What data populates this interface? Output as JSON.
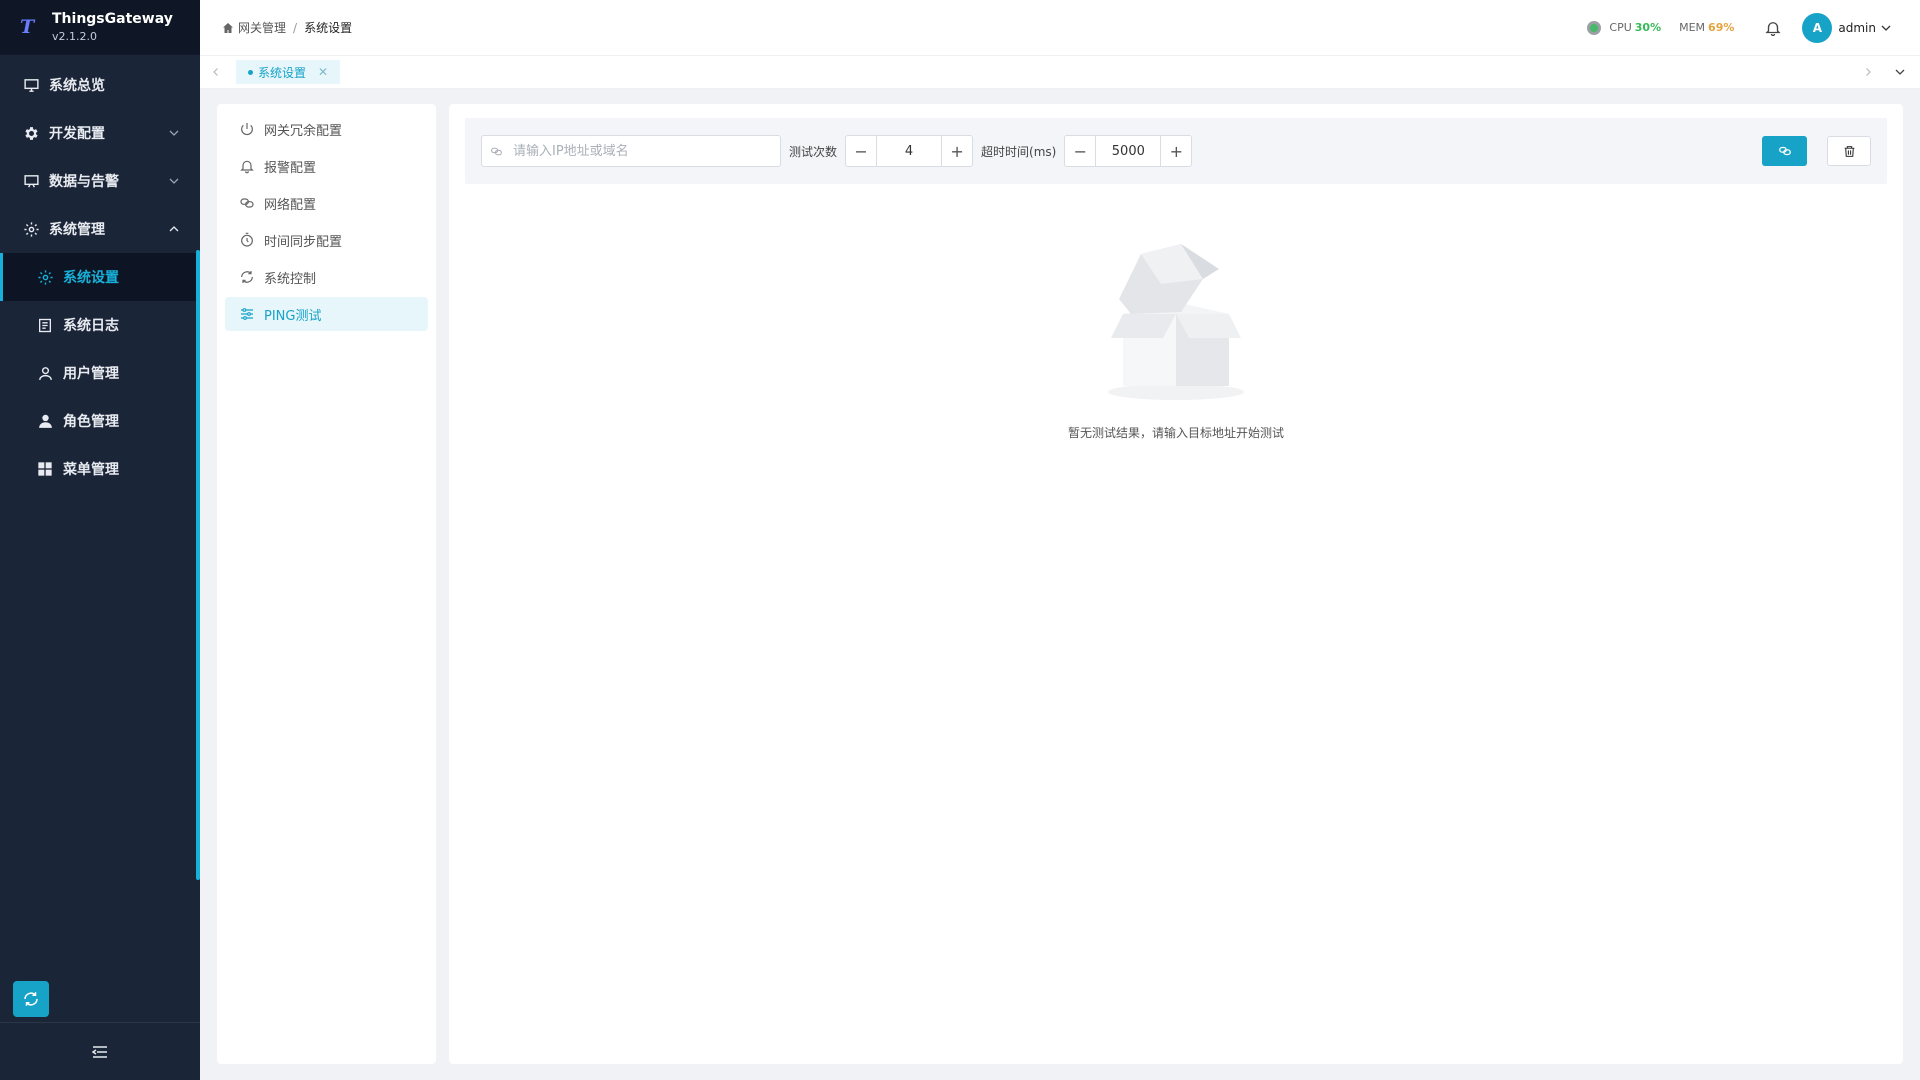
{
  "app": {
    "name": "ThingsGateway",
    "version": "v2.1.2.0"
  },
  "sidebar": {
    "items": [
      {
        "label": "系统总览",
        "icon": "monitor-icon"
      },
      {
        "label": "开发配置",
        "icon": "gear-icon"
      },
      {
        "label": "数据与告警",
        "icon": "monitor-icon"
      },
      {
        "label": "系统管理",
        "icon": "gear-icon"
      },
      {
        "label": "系统设置",
        "icon": "gear-icon"
      },
      {
        "label": "系统日志",
        "icon": "document-icon"
      },
      {
        "label": "用户管理",
        "icon": "user-icon"
      },
      {
        "label": "角色管理",
        "icon": "user-solid-icon"
      },
      {
        "label": "菜单管理",
        "icon": "grid-icon"
      }
    ]
  },
  "header": {
    "breadcrumb": [
      "网关管理",
      "系统设置"
    ],
    "cpu_label": "CPU",
    "cpu_value": "30%",
    "mem_label": "MEM",
    "mem_value": "69%",
    "avatar_letter": "A",
    "username": "admin"
  },
  "tabs": [
    {
      "label": "系统设置",
      "active": true
    }
  ],
  "settings_nav": {
    "items": [
      {
        "label": "网关冗余配置",
        "icon": "power-icon"
      },
      {
        "label": "报警配置",
        "icon": "bell-icon"
      },
      {
        "label": "网络配置",
        "icon": "link-icon"
      },
      {
        "label": "时间同步配置",
        "icon": "stopwatch-icon"
      },
      {
        "label": "系统控制",
        "icon": "refresh-icon"
      },
      {
        "label": "PING测试",
        "icon": "sliders-icon"
      }
    ]
  },
  "ping": {
    "input_placeholder": "请输入IP地址或域名",
    "count_label": "测试次数",
    "count_value": "4",
    "timeout_label": "超时时间(ms)",
    "timeout_value": "5000",
    "empty_text": "暂无测试结果，请输入目标地址开始测试"
  },
  "colors": {
    "accent": "#17a2c7",
    "sidebar_bg": "#1b2538",
    "cpu": "#38b95a",
    "mem": "#e6a23c"
  }
}
